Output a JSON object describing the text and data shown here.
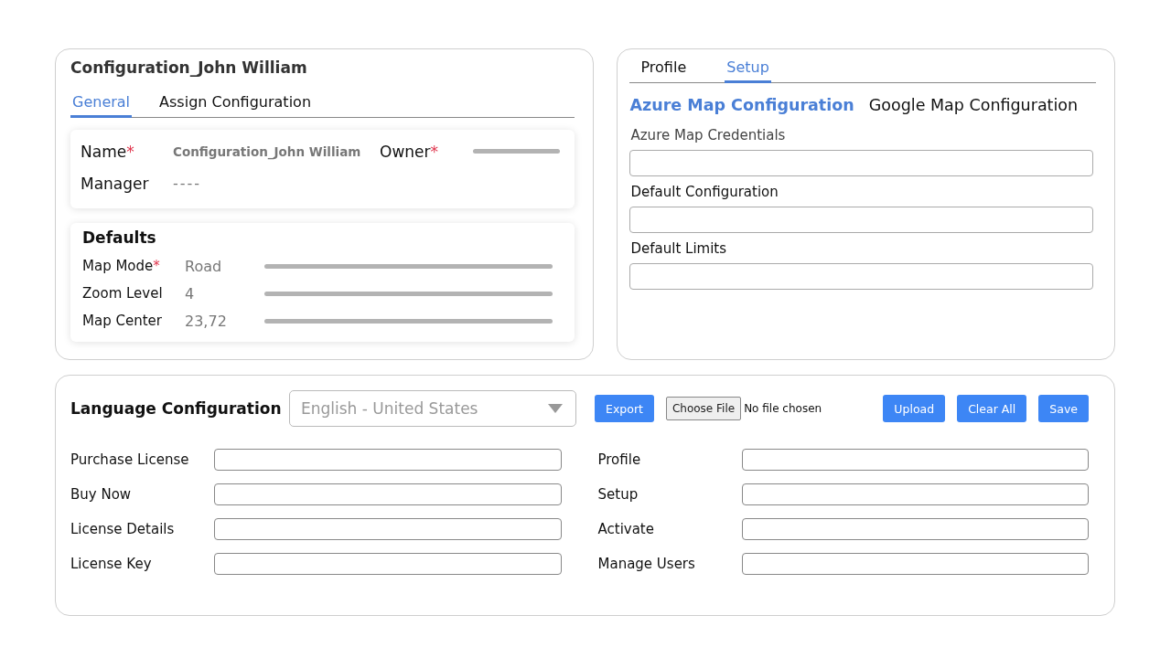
{
  "config_card": {
    "title": "Configuration_John William",
    "tabs": [
      {
        "label": "General",
        "selected": true
      },
      {
        "label": "Assign Configuration",
        "selected": false
      }
    ],
    "info": [
      {
        "label": "Name",
        "required_mark": "*",
        "value": "Configuration_John William"
      },
      {
        "label": "Owner",
        "required_mark": "*"
      },
      {
        "label": "Manager",
        "value": "----"
      }
    ],
    "defaults": {
      "title": "Defaults",
      "rows": [
        {
          "label": "Map Mode",
          "required_mark": "*",
          "value": "Road"
        },
        {
          "label": "Zoom Level",
          "value": "4"
        },
        {
          "label": "Map Center",
          "value": "23,72"
        }
      ]
    }
  },
  "setup_card": {
    "tabs": [
      {
        "label": "Profile",
        "selected": false
      },
      {
        "label": "Setup",
        "selected": true
      }
    ],
    "sections": [
      {
        "label": "Azure Map Configuration",
        "selected": true
      },
      {
        "label": "Google Map Configuration",
        "selected": false
      }
    ],
    "fields": [
      {
        "label": "Azure Map Credentials"
      },
      {
        "label": "Default Configuration"
      },
      {
        "label": "Default Limits"
      }
    ]
  },
  "language_card": {
    "title": "Language Configuration",
    "language": "English - United States",
    "export": "Export",
    "choose_file": "Choose File",
    "file_status": "No file chosen",
    "buttons": [
      "Upload",
      "Clear All",
      "Save"
    ],
    "fields_left": [
      "Purchase License",
      "Buy Now",
      "License Details",
      "License Key"
    ],
    "fields_right": [
      "Profile",
      "Setup",
      "Activate",
      "Manage Users"
    ]
  }
}
